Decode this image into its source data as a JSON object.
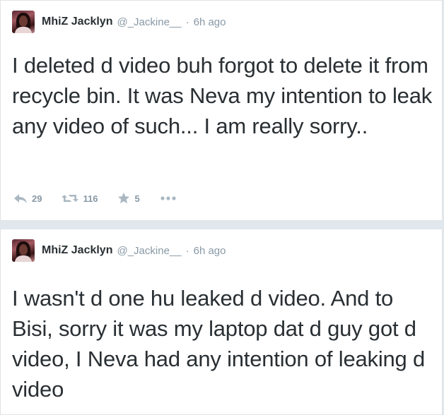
{
  "tweets": [
    {
      "name": "MhiZ Jacklyn",
      "handle": "@_Jackine__",
      "separator": "·",
      "time": "6h ago",
      "text": "I deleted d video buh forgot to delete it from recycle bin. It was Neva my intention to leak any video of such... I am really sorry..",
      "replies": "29",
      "retweets": "116",
      "favorites": "5",
      "icons": [
        "reply-icon",
        "retweet-icon",
        "favorite-icon",
        "more-icon"
      ]
    },
    {
      "name": "MhiZ Jacklyn",
      "handle": "@_Jackine__",
      "separator": "·",
      "time": "6h ago",
      "text": "I wasn't d one hu leaked d video. And to Bisi, sorry it was my laptop dat d guy got d video, I Neva had any intention of leaking d video"
    }
  ],
  "colors": {
    "text": "#292f33",
    "muted": "#8899a6",
    "background": "#e1e8ed"
  }
}
